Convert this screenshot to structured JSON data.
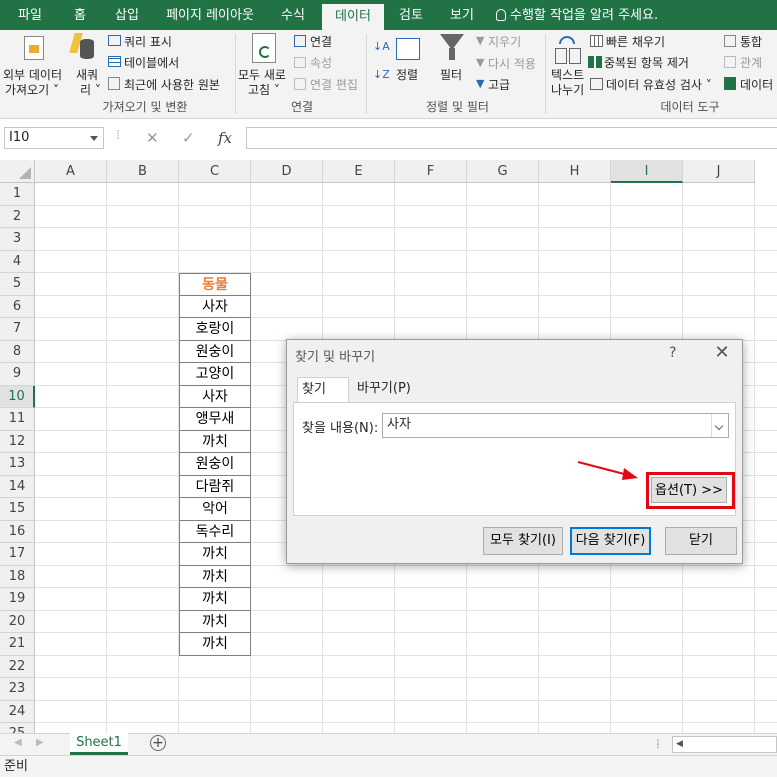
{
  "ribbon_tabs": [
    "파일",
    "홈",
    "삽입",
    "페이지 레이아웃",
    "수식",
    "데이터",
    "검토",
    "보기"
  ],
  "active_tab": "데이터",
  "tell_me": "수행할 작업을 알려 주세요.",
  "ribbon": {
    "get_external_data_1": "외부 데이터",
    "get_external_data_2": "가져오기 ˅",
    "new_query_1": "새쿼",
    "new_query_2": "리 ˅",
    "show_queries": "쿼리 표시",
    "from_table": "테이블에서",
    "recent_sources": "최근에 사용한 원본",
    "group_get_transform": "가져오기 및 변환",
    "refresh_all_1": "모두 새로",
    "refresh_all_2": "고침 ˅",
    "connections": "연결",
    "properties": "속성",
    "edit_links": "연결 편집",
    "group_connections": "연결",
    "sort": "정렬",
    "filter": "필터",
    "clear": "지우기",
    "reapply": "다시 적용",
    "advanced": "고급",
    "group_sort_filter": "정렬 및 필터",
    "text_to_columns_1": "텍스트",
    "text_to_columns_2": "나누기",
    "flash_fill": "빠른 채우기",
    "remove_duplicates": "중복된 항목 제거",
    "data_validation": "데이터 유효성 검사 ˅",
    "consolidate": "통합",
    "relationships": "관계",
    "data_model": "데이터",
    "group_data_tools": "데이터 도구"
  },
  "formula_bar": {
    "name_box": "I10",
    "cancel": "✕",
    "enter": "✓",
    "fx": "fx",
    "value": ""
  },
  "columns": [
    "A",
    "B",
    "C",
    "D",
    "E",
    "F",
    "G",
    "H",
    "I",
    "J"
  ],
  "rows": [
    "1",
    "2",
    "3",
    "4",
    "5",
    "6",
    "7",
    "8",
    "9",
    "10",
    "11",
    "12",
    "13",
    "14",
    "15",
    "16",
    "17",
    "18",
    "19",
    "20",
    "21",
    "22",
    "23",
    "24",
    "25"
  ],
  "selected_cell": {
    "column": "I",
    "row": "10"
  },
  "table": {
    "header": "동물",
    "values": [
      "사자",
      "호랑이",
      "원숭이",
      "고양이",
      "사자",
      "앵무새",
      "까치",
      "원숭이",
      "다람쥐",
      "악어",
      "독수리",
      "까치",
      "까치",
      "까치",
      "까치",
      "까치"
    ]
  },
  "sheet_tabs": [
    "Sheet1"
  ],
  "status": "준비",
  "dialog": {
    "title": "찾기 및 바꾸기",
    "help": "?",
    "close": "✕",
    "tab_find": "찾기(D)",
    "tab_replace": "바꾸기(P)",
    "find_label": "찾을 내용(N):",
    "find_value": "사자",
    "options_button": "옵션(T) >>",
    "find_all_button": "모두 찾기(I)",
    "find_next_button": "다음 찾기(F)",
    "close_button": "닫기"
  },
  "colors": {
    "excel_green": "#217346",
    "highlight_red": "#e30613",
    "header_orange": "#ed7d31"
  }
}
